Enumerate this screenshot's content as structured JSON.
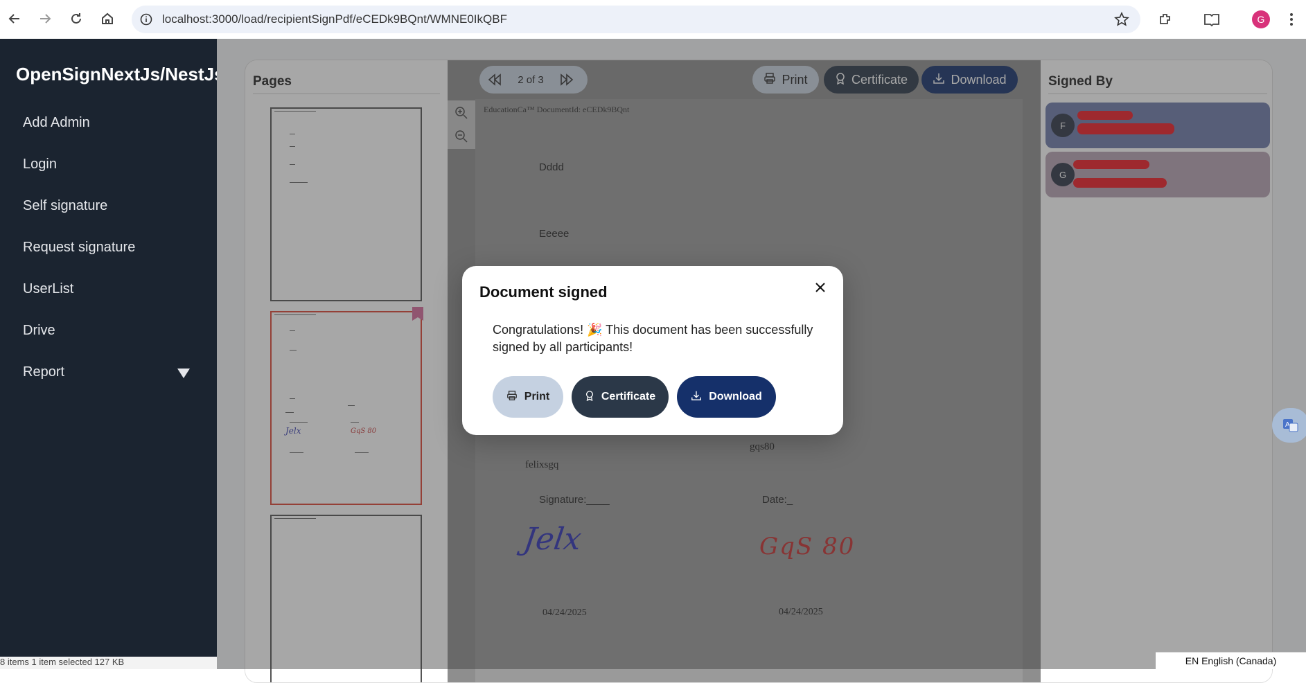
{
  "browser": {
    "url": "localhost:3000/load/recipientSignPdf/eCEDk9BQnt/WMNE0IkQBF",
    "profile_initial": "G"
  },
  "sidebar": {
    "brand": "OpenSignNextJs/NestJs",
    "items": [
      {
        "label": "Add Admin"
      },
      {
        "label": "Login"
      },
      {
        "label": "Self signature"
      },
      {
        "label": "Request signature"
      },
      {
        "label": "UserList"
      },
      {
        "label": "Drive"
      },
      {
        "label": "Report"
      }
    ]
  },
  "pages_panel": {
    "title": "Pages"
  },
  "viewer": {
    "page_indicator": "2 of 3",
    "print_label": "Print",
    "certificate_label": "Certificate",
    "download_label": "Download",
    "doc_header": "EducationCa™ DocumentId: eCEDk9BQnt",
    "lines": {
      "line1": "Dddd",
      "line2": "Eeeee",
      "signer2_name": "gqs80",
      "signer1_name": "felixsgq",
      "signature_label": "Signature:____",
      "date_label": "Date:_",
      "signature1": "Jelx",
      "signature2": "GqS 80",
      "date1": "04/24/2025",
      "date2": "04/24/2025"
    }
  },
  "signed_by": {
    "title": "Signed By",
    "signers": [
      {
        "initial": "F",
        "color": "#6d7aaa"
      },
      {
        "initial": "G",
        "color": "#b7a2b3"
      }
    ]
  },
  "modal": {
    "title": "Document signed",
    "message": "Congratulations! 🎉 This document has been successfully signed by all participants!",
    "print_label": "Print",
    "certificate_label": "Certificate",
    "download_label": "Download"
  },
  "taskbar": {
    "status": "8 items     1 item selected  127 KB",
    "language": "EN English (Canada)"
  }
}
